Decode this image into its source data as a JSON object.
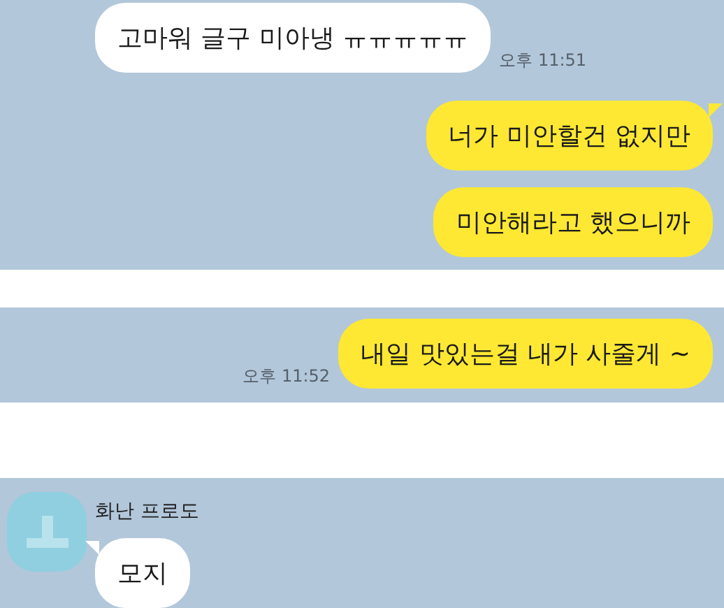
{
  "sections": [
    {
      "messages": [
        {
          "kind": "received",
          "text": "고마워 글구 미아냉 ㅠㅠㅠㅠㅠ",
          "time": "오후 11:51",
          "tail": false
        },
        {
          "kind": "sent",
          "text": "너가 미안할건 없지만",
          "tail": true
        },
        {
          "kind": "sent",
          "text": "미안해라고 했으니까",
          "tail": false
        }
      ]
    },
    {
      "messages": [
        {
          "kind": "sent",
          "text": "내일 맛있는걸 내가 사줄게 ~",
          "time": "오후 11:52",
          "tail": false
        }
      ]
    },
    {
      "sender": "화난 프로도",
      "messages": [
        {
          "kind": "received",
          "text": "모지",
          "tail": true
        }
      ]
    }
  ]
}
